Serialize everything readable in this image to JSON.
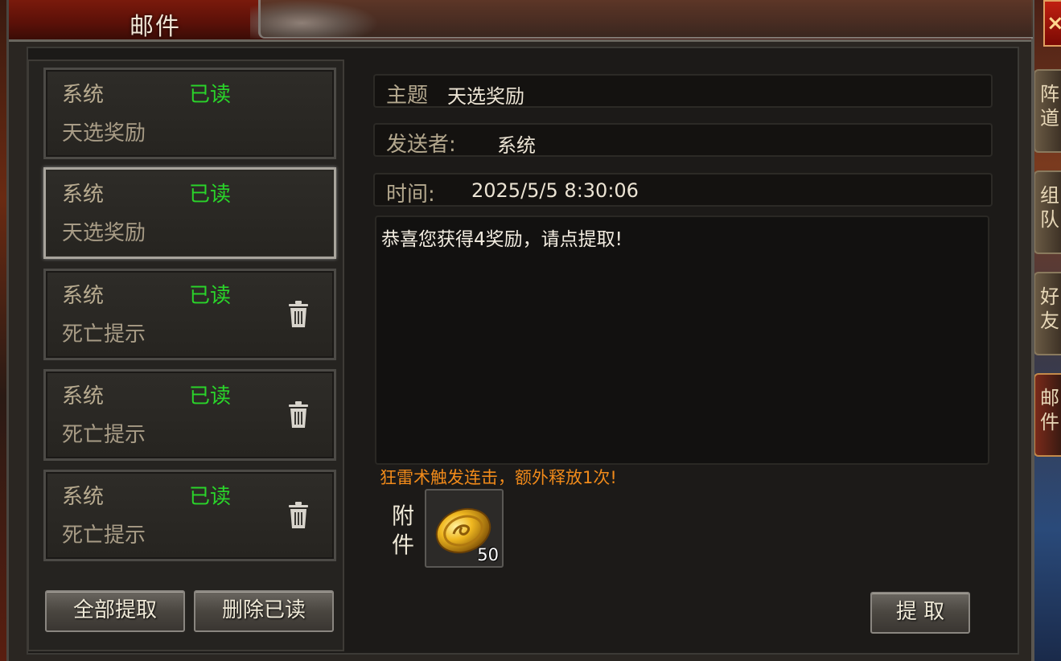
{
  "window": {
    "title": "邮件",
    "close_label": "×"
  },
  "side_tabs": [
    {
      "label": "阵\n道"
    },
    {
      "label": "组\n队"
    },
    {
      "label": "好\n友"
    },
    {
      "label": "邮\n件"
    }
  ],
  "mail_list": [
    {
      "sender": "系统",
      "status": "已读",
      "subject": "天选奖励",
      "has_delete": false,
      "selected": false
    },
    {
      "sender": "系统",
      "status": "已读",
      "subject": "天选奖励",
      "has_delete": false,
      "selected": true
    },
    {
      "sender": "系统",
      "status": "已读",
      "subject": "死亡提示",
      "has_delete": true,
      "selected": false
    },
    {
      "sender": "系统",
      "status": "已读",
      "subject": "死亡提示",
      "has_delete": true,
      "selected": false
    },
    {
      "sender": "系统",
      "status": "已读",
      "subject": "死亡提示",
      "has_delete": true,
      "selected": false
    }
  ],
  "list_buttons": {
    "collect_all": "全部提取",
    "delete_read": "删除已读"
  },
  "detail": {
    "subject_label": "主题",
    "subject_value": "天选奖励",
    "sender_label": "发送者:",
    "sender_value": "系统",
    "time_label": "时间:",
    "time_value": "2025/5/5 8:30:06",
    "body": "恭喜您获得4奖励，请点提取!",
    "notice": "狂雷术触发连击，额外释放1次!",
    "attachment_label": "附\n件",
    "attachment": {
      "icon": "gold-coin-icon",
      "count": "50"
    },
    "collect_button": "提 取"
  },
  "colors": {
    "read_status": "#2ad42a",
    "notice": "#f08a1a",
    "title_bar": "#7a1a0c"
  }
}
